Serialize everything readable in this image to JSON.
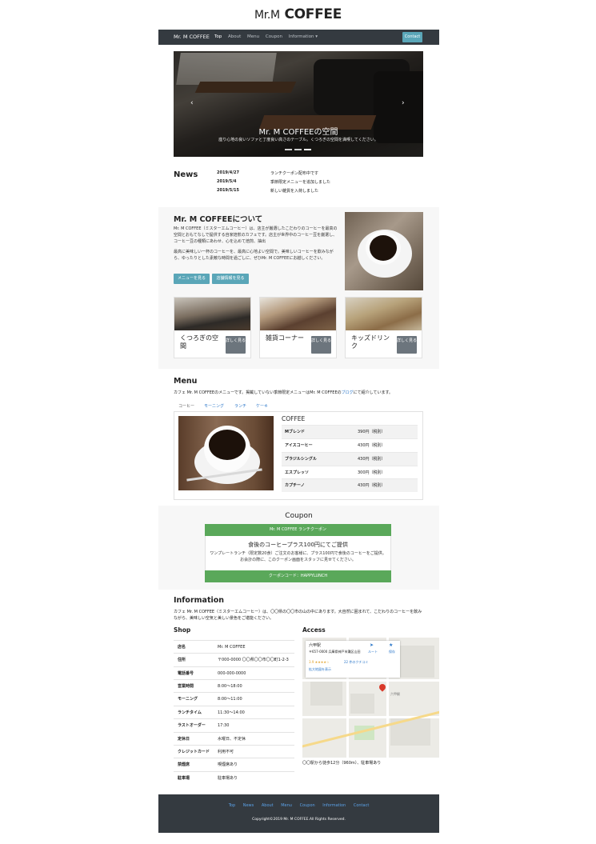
{
  "logo": {
    "prefix": "Mr.M",
    "main": "COFFEE"
  },
  "nav": {
    "brand": "Mr. M COFFEE",
    "links": [
      "Top",
      "About",
      "Menu",
      "Coupon",
      "Information ▾"
    ],
    "contact": "Contact"
  },
  "hero": {
    "title": "Mr. M COFFEEの空間",
    "subtitle": "座り心地の良いソファと丁度良い高さのテーブル。くつろぎの空間を満喫してください。",
    "prev_icon": "chevron-left-icon",
    "next_icon": "chevron-right-icon"
  },
  "news": {
    "heading": "News",
    "items": [
      {
        "date": "2019/4/27",
        "text": "ランチクーポン配布中です"
      },
      {
        "date": "2019/5/4",
        "text": "季節限定メニューを追加しました"
      },
      {
        "date": "2019/5/15",
        "text": "新しい雑貨を入荷しました"
      }
    ]
  },
  "about": {
    "heading": "Mr. M COFFEEについて",
    "p1": "Mr. M COFFEE（ミスターエムコーヒー）は、店主が厳選したこだわりのコーヒーを最高の空間とおもてなしで提供する自家焙煎のカフェです。店主が世界中のコーヒー豆を厳選し、コーヒー豆の種類にあわせ、心を込めて焙煎、抽出",
    "p2": "最高に美味しい一杯のコーヒーを、最高に心地よい空間で。美味しいコーヒーを飲みながら、ゆったりとした素敵な時間を過ごしに、ぜひMr. M COFFEEにお越しください。",
    "btn_menu": "メニューを見る",
    "btn_store": "店舗情報を見る"
  },
  "cards": [
    {
      "title": "くつろぎの空間",
      "button": "詳しく見る"
    },
    {
      "title": "雑貨コーナー",
      "button": "詳しく見る"
    },
    {
      "title": "キッズドリンク",
      "button": "詳しく見る"
    }
  ],
  "menu": {
    "heading": "Menu",
    "intro_before": "カフェ Mr. M COFFEEのメニューです。掲載していない季節限定メニューはMr. M COFFEEの",
    "intro_link": "ブログ",
    "intro_after": "にて紹介しています。",
    "tabs": [
      "コーヒー",
      "モーニング",
      "ランチ",
      "ケーキ"
    ],
    "category": "COFFEE",
    "items": [
      {
        "name": "Mブレンド",
        "price": "390円（税別）"
      },
      {
        "name": "アイスコーヒー",
        "price": "430円（税別）"
      },
      {
        "name": "ブラジルシングル",
        "price": "430円（税別）"
      },
      {
        "name": "エスプレッソ",
        "price": "300円（税別）"
      },
      {
        "name": "カプチーノ",
        "price": "430円（税別）"
      }
    ]
  },
  "coupon": {
    "heading": "Coupon",
    "header": "Mr. M COFFEE ランチクーポン",
    "title": "食後のコーヒープラス100円にてご提供",
    "text": "ワンプレートランチ（限定数20食）ご注文のお客様に、プラス100円で食後のコーヒーをご提供。お会計の際に、このクーポン画面をスタッフに見せてください。",
    "code": "クーポンコード：HAPPYLUNCH"
  },
  "information": {
    "heading": "Information",
    "text": "カフェ Mr. M COFFEE（ミスターエムコーヒー）は、〇〇県の〇〇市の山の中にあります。大自然に囲まれて、こだわりのコーヒーを飲みながら、美味しい空気と美しい景色をご堪能ください。"
  },
  "shop": {
    "heading": "Shop",
    "rows": [
      {
        "k": "店名",
        "v": "Mr. M COFFEE"
      },
      {
        "k": "住所",
        "v": "〒000-0000 〇〇県〇〇市〇〇町1-2-3"
      },
      {
        "k": "電話番号",
        "v": "000-000-0000"
      },
      {
        "k": "営業時間",
        "v": "8:00〜18:00"
      },
      {
        "k": "モーニング",
        "v": "8:00〜11:00"
      },
      {
        "k": "ランチタイム",
        "v": "11:30〜14:00"
      },
      {
        "k": "ラストオーダー",
        "v": "17:30"
      },
      {
        "k": "定休日",
        "v": "水曜日、不定休"
      },
      {
        "k": "クレジットカード",
        "v": "利用不可"
      },
      {
        "k": "禁煙席",
        "v": "喫煙席あり"
      },
      {
        "k": "駐車場",
        "v": "駐車場あり"
      }
    ]
  },
  "access": {
    "heading": "Access",
    "map_place": "六甲駅",
    "map_address": "〒657-0000 兵庫県神戸市灘区山田",
    "map_route": "ルート",
    "map_save": "保存",
    "map_rating": "3.9 ★★★★☆",
    "map_reviews": "22 件のクチコミ",
    "map_more": "拡大地図を表示",
    "note": "〇〇駅から徒歩12分（960m）、駐車場あり"
  },
  "footer": {
    "links": [
      "Top",
      "News",
      "About",
      "Menu",
      "Coupon",
      "Information",
      "Contact"
    ],
    "copyright": "Copyright©2019 Mr. M COFFEE.All Rights Reserved."
  }
}
